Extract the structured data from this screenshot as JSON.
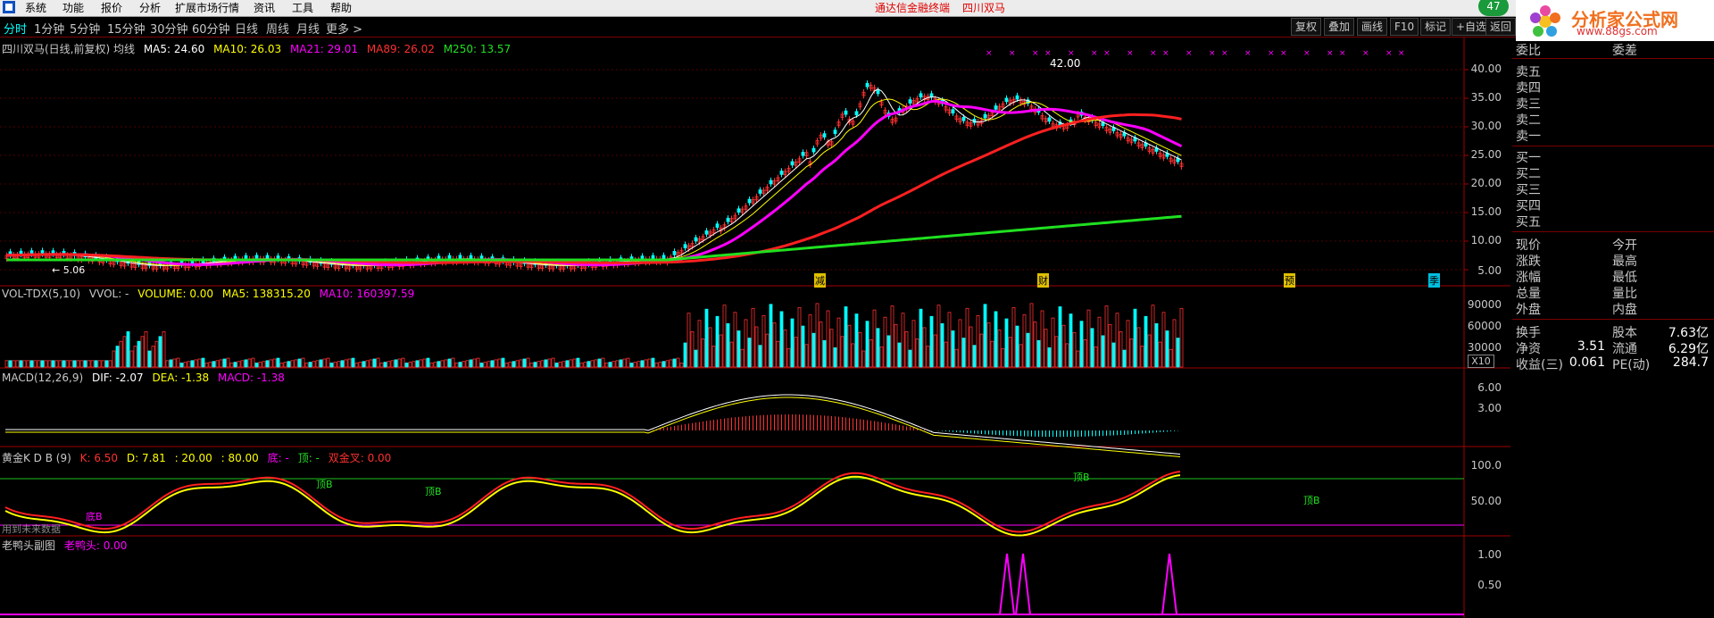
{
  "menu": {
    "items": [
      "系统",
      "功能",
      "报价",
      "分析",
      "扩展市场行情",
      "资讯",
      "工具",
      "帮助"
    ],
    "center_left": "通达信金融终端",
    "center_right": "四川双马"
  },
  "toolbar": {
    "timeframes": [
      "分时",
      "1分钟",
      "5分钟",
      "15分钟",
      "30分钟",
      "60分钟",
      "日线",
      "周线",
      "月线",
      "更多 >"
    ],
    "right_buttons": [
      "复权",
      "叠加",
      "画线",
      "F10",
      "标记",
      "+自选",
      "返回"
    ]
  },
  "logo": {
    "title": "分析家公式网",
    "url": "www.88gs.com",
    "badge": "47"
  },
  "main_chart": {
    "legend": {
      "name": "四川双马(日线,前复权) 均线",
      "ma5": "MA5: 24.60",
      "ma10": "MA10: 26.03",
      "ma21": "MA21: 29.01",
      "ma89": "MA89: 26.02",
      "ma250": "M250: 13.57"
    },
    "y_labels": [
      "40.00",
      "35.00",
      "30.00",
      "25.00",
      "20.00",
      "15.00",
      "10.00",
      "5.00"
    ],
    "high_label": "42.00",
    "low_label": "← 5.06",
    "markers": [
      "减",
      "财",
      "预",
      "季"
    ],
    "colors": {
      "ma5": "#ffffff",
      "ma10": "#ffff00",
      "ma21": "#ff00ff",
      "ma89": "#ff2020",
      "ma250": "#20e020",
      "up": "#ff3030",
      "down": "#00ffff"
    }
  },
  "volume_chart": {
    "legend": {
      "name": "VOL-TDX(5,10)",
      "vvol": "VVOL: -",
      "volume": "VOLUME: 0.00",
      "ma5": "MA5: 138315.20",
      "ma10": "MA10: 160397.59"
    },
    "y_labels": [
      "90000",
      "60000",
      "30000"
    ],
    "unit": "X10"
  },
  "macd_chart": {
    "legend": {
      "name": "MACD(12,26,9)",
      "dif": "DIF: -2.07",
      "dea": "DEA: -1.38",
      "macd": "MACD: -1.38"
    },
    "y_labels": [
      "6.00",
      "3.00"
    ]
  },
  "kdj_chart": {
    "legend": {
      "name": "黄金K D B (9)",
      "k": "K: 6.50",
      "d": "D: 7.81",
      "l20": ": 20.00",
      "l80": ": 80.00",
      "di": "底: -",
      "ding": "顶: -",
      "cross": "双金叉: 0.00"
    },
    "y_labels": [
      "100.0",
      "50.00"
    ],
    "tags": [
      "顶B",
      "顶B",
      "顶B",
      "顶B",
      "底B"
    ],
    "note": "用到未来数据"
  },
  "duck_chart": {
    "legend": {
      "name": "老鸭头副图",
      "value": "老鸭头: 0.00"
    },
    "y_labels": [
      "1.00",
      "0.50"
    ]
  },
  "sidebar": {
    "header_left": "委比",
    "header_right": "委差",
    "sell": [
      "卖五",
      "卖四",
      "卖三",
      "卖二",
      "卖一"
    ],
    "buy": [
      "买一",
      "买二",
      "买三",
      "买四",
      "买五"
    ],
    "quote_rows": [
      {
        "l": "现价",
        "r": "今开"
      },
      {
        "l": "涨跌",
        "r": "最高"
      },
      {
        "l": "涨幅",
        "r": "最低"
      },
      {
        "l": "总量",
        "r": "量比"
      },
      {
        "l": "外盘",
        "r": "内盘"
      }
    ],
    "finance_rows": [
      {
        "l": "换手",
        "lv": "",
        "r": "股本",
        "rv": "7.63亿"
      },
      {
        "l": "净资",
        "lv": "3.51",
        "r": "流通",
        "rv": "6.29亿"
      },
      {
        "l": "收益(三)",
        "lv": "0.061",
        "r": "PE(动)",
        "rv": "284.7"
      }
    ]
  }
}
